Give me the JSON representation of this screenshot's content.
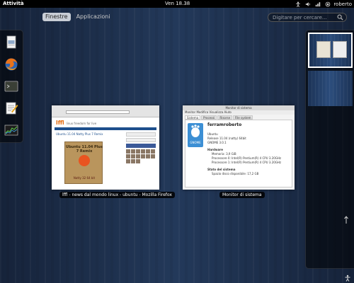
{
  "top_panel": {
    "activities": "Attività",
    "clock": "Ven 18.38",
    "username": "roberto",
    "tray_icons": [
      "accessibility-icon",
      "volume-icon",
      "network-icon",
      "user-icon"
    ]
  },
  "overview": {
    "tabs": [
      {
        "label": "Finestre",
        "active": true
      },
      {
        "label": "Applicazioni",
        "active": false
      }
    ],
    "search": {
      "placeholder": "Digitare per cercare..."
    }
  },
  "dash": {
    "items": [
      "files-icon",
      "firefox-icon",
      "terminal-icon",
      "text-editor-icon",
      "system-monitor-icon"
    ]
  },
  "windows": [
    {
      "caption": "lffl - news dal mondo linux - ubuntu - Mozilla Firefox",
      "page": {
        "site_name": "lffl",
        "tagline": "linux freedom for live",
        "post_title": "Ubuntu 11.04 Natty Plus 7 Remix",
        "poster_title": "Ubuntu 11.04 Plus 7 Remix",
        "poster_subtitle": "Natty 32 64 bit"
      }
    },
    {
      "caption": "Monitor di sistema",
      "app": {
        "title": "Monitor di sistema",
        "menu": "Monitor  Modifica  Visualizza  Aiuto",
        "tabs": [
          "Sistema",
          "Processi",
          "Risorse",
          "File system"
        ],
        "hostname": "ferramroberto",
        "logo_label": "GNOME",
        "lines": [
          "Ubuntu",
          "Release 11.04 (natty) 64bit",
          "GNOME 3.0.1",
          "Hardware",
          "Memoria: 3,9 GiB",
          "Processore 0: Intel(R) Pentium(R) 4 CPU 3.20GHz",
          "Processore 1: Intel(R) Pentium(R) 4 CPU 3.20GHz",
          "Stato del sistema",
          "Spazio disco disponibile: 17,2 GB"
        ]
      }
    }
  ],
  "workspaces": {
    "count": 2,
    "active": 1
  }
}
